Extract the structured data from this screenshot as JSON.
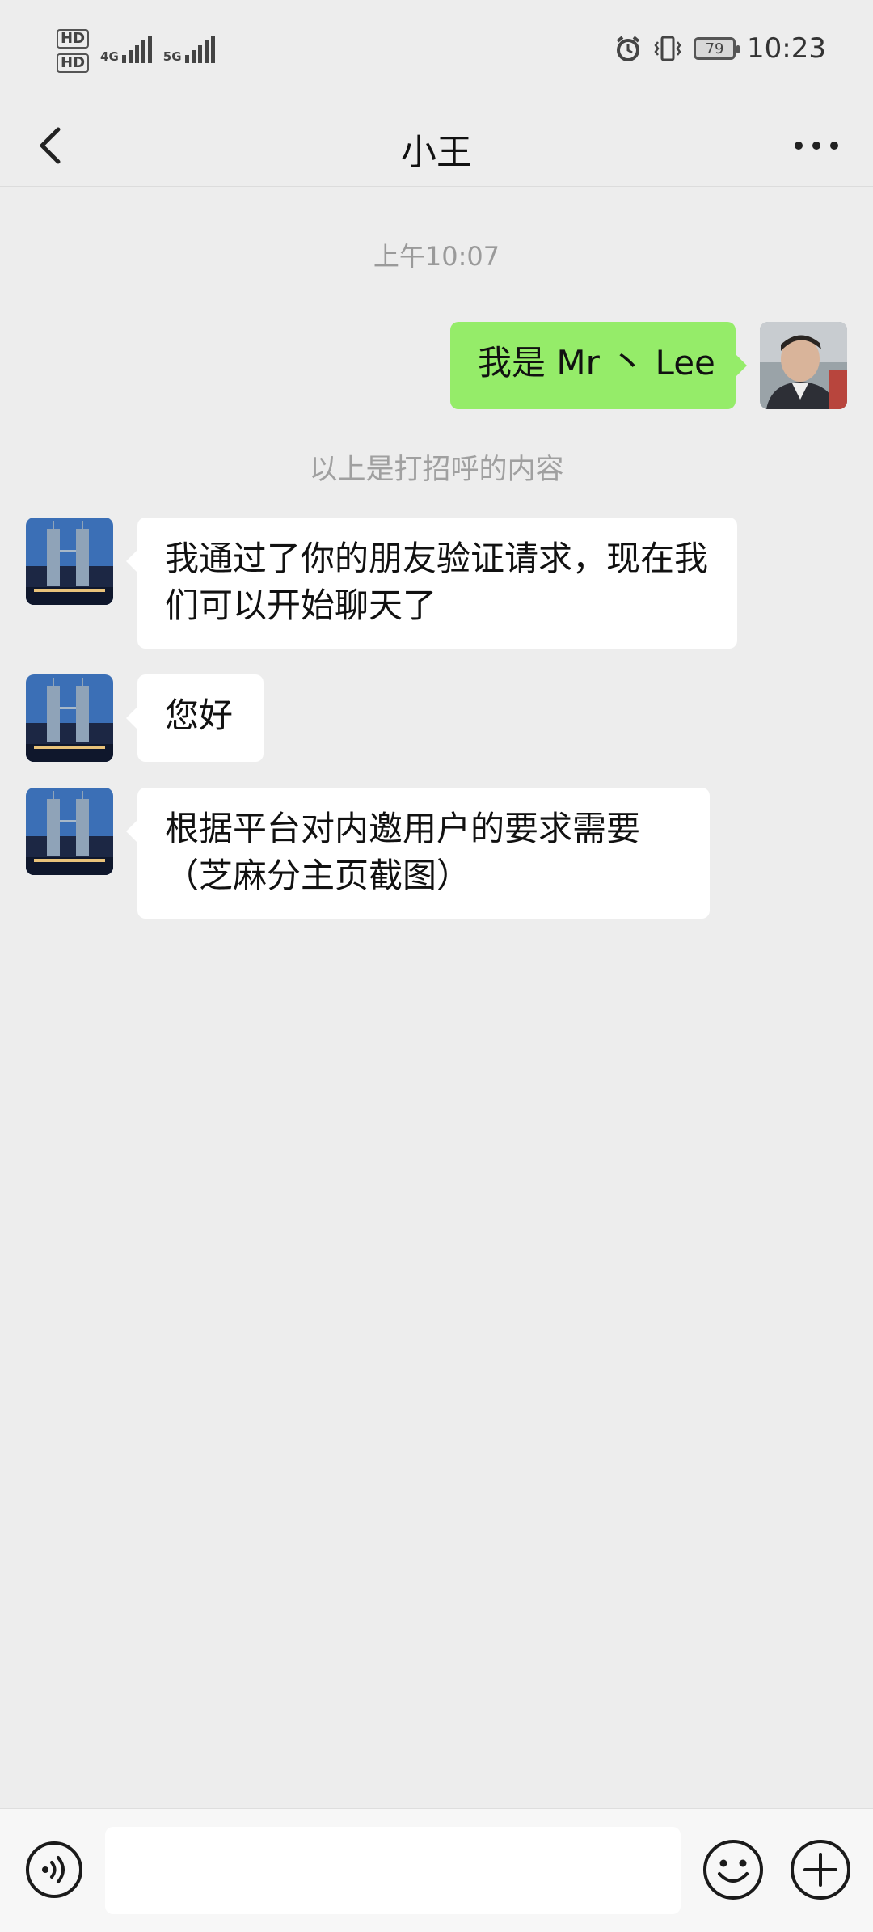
{
  "status_bar": {
    "hd1": "HD",
    "hd2": "HD",
    "net1": "4G",
    "net2": "5G",
    "battery": "79",
    "time": "10:23"
  },
  "header": {
    "title": "小王",
    "back_icon": "chevron-left-icon",
    "more_icon": "more-horizontal-icon"
  },
  "chat": {
    "timestamp": "上午10:07",
    "system_note": "以上是打招呼的内容",
    "messages": [
      {
        "side": "out",
        "text": "我是 Mr 丶 Lee"
      },
      {
        "side": "in",
        "text": "我通过了你的朋友验证请求，现在我们可以开始聊天了"
      },
      {
        "side": "in",
        "text": "您好"
      },
      {
        "side": "in",
        "text": "根据平台对内邀用户的要求需要（芝麻分主页截图）"
      }
    ]
  },
  "input_bar": {
    "placeholder": "",
    "voice_icon": "voice-icon",
    "emoji_icon": "emoji-icon",
    "plus_icon": "plus-circle-icon"
  },
  "colors": {
    "background": "#ededed",
    "outgoing_bubble": "#95ec69",
    "incoming_bubble": "#ffffff"
  }
}
